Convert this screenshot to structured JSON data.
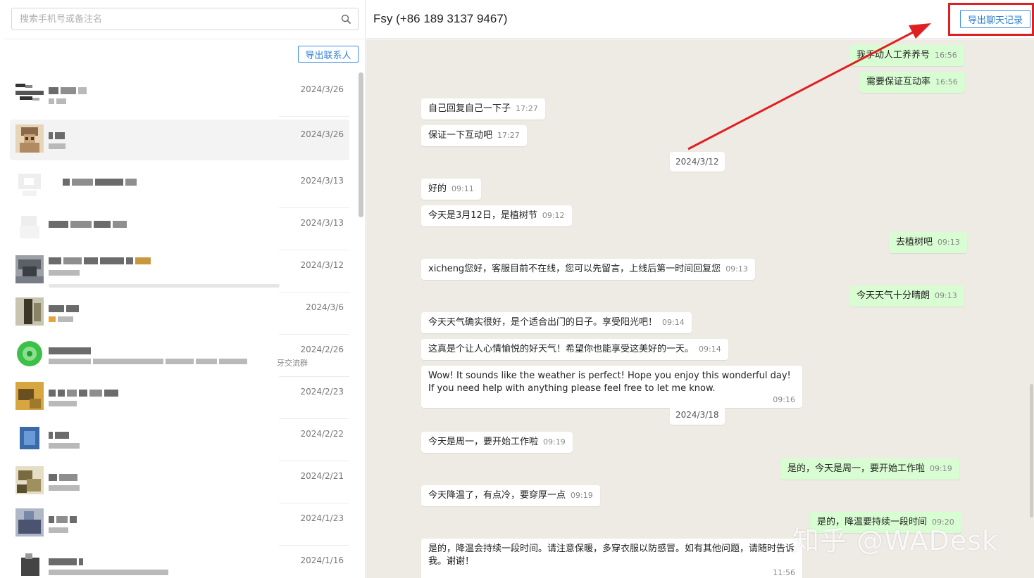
{
  "search": {
    "placeholder": "搜索手机号或备注名"
  },
  "sidebar": {
    "export_contacts_label": "导出联系人",
    "contacts": [
      {
        "date": "2024/3/26",
        "active": false
      },
      {
        "date": "2024/3/26",
        "active": true
      },
      {
        "date": "2024/3/13",
        "active": false
      },
      {
        "date": "2024/3/13",
        "active": false
      },
      {
        "date": "2024/3/12",
        "active": false
      },
      {
        "date": "2024/3/6",
        "active": false
      },
      {
        "date": "2024/2/26",
        "active": false,
        "extra": "牙交流群"
      },
      {
        "date": "2024/2/23",
        "active": false
      },
      {
        "date": "2024/2/22",
        "active": false
      },
      {
        "date": "2024/2/21",
        "active": false
      },
      {
        "date": "2024/1/23",
        "active": false
      },
      {
        "date": "2024/1/16",
        "active": false
      }
    ]
  },
  "chat": {
    "title": "Fsy (+86 189 3137 9467)",
    "export_label": "导出聊天记录",
    "messages": [
      {
        "kind": "out",
        "text": "我手动人工养养号",
        "time": "16:56"
      },
      {
        "kind": "out",
        "text": "需要保证互动率",
        "time": "16:56"
      },
      {
        "kind": "in",
        "text": "自己回复自己一下子",
        "time": "17:27"
      },
      {
        "kind": "in",
        "text": "保证一下互动吧",
        "time": "17:27"
      },
      {
        "kind": "date",
        "text": "2024/3/12"
      },
      {
        "kind": "in",
        "text": "好的",
        "time": "09:11"
      },
      {
        "kind": "in",
        "text": "今天是3月12日，是植树节",
        "time": "09:12"
      },
      {
        "kind": "out",
        "text": "去植树吧",
        "time": "09:13"
      },
      {
        "kind": "in",
        "text": "xicheng您好，客服目前不在线，您可以先留言，上线后第一时间回复您",
        "time": "09:13"
      },
      {
        "kind": "out",
        "text": "今天天气十分晴朗",
        "time": "09:13"
      },
      {
        "kind": "in",
        "text": "今天天气确实很好，是个适合出门的日子。享受阳光吧！",
        "time": "09:14"
      },
      {
        "kind": "in",
        "text": "这真是个让人心情愉悦的好天气！希望你也能享受这美好的一天。",
        "time": "09:14"
      },
      {
        "kind": "in",
        "text": "Wow! It sounds like the weather is perfect! Hope you enjoy this wonderful day! If you need help with anything please feel free to let me know.",
        "time": "09:16"
      },
      {
        "kind": "date",
        "text": "2024/3/18"
      },
      {
        "kind": "in",
        "text": "今天是周一，要开始工作啦",
        "time": "09:19"
      },
      {
        "kind": "out",
        "text": "是的，今天是周一，要开始工作啦",
        "time": "09:19"
      },
      {
        "kind": "in",
        "text": "今天降温了，有点冷，要穿厚一点",
        "time": "09:19"
      },
      {
        "kind": "out",
        "text": "是的，降温要持续一段时间",
        "time": "09:20"
      },
      {
        "kind": "in",
        "text": "是的，降温会持续一段时间。请注意保暖，多穿衣服以防感冒。如有其他问题，请随时告诉我。谢谢！",
        "time": "11:56"
      }
    ]
  },
  "watermark": "知乎 @WADesk",
  "colors": {
    "accent": "#2f7fd3",
    "outgoing_bubble": "#d9fdd3",
    "incoming_bubble": "#ffffff",
    "chat_background": "#eeeae4",
    "annotation_red": "#e02020"
  },
  "icons": {
    "search": "search-icon"
  }
}
